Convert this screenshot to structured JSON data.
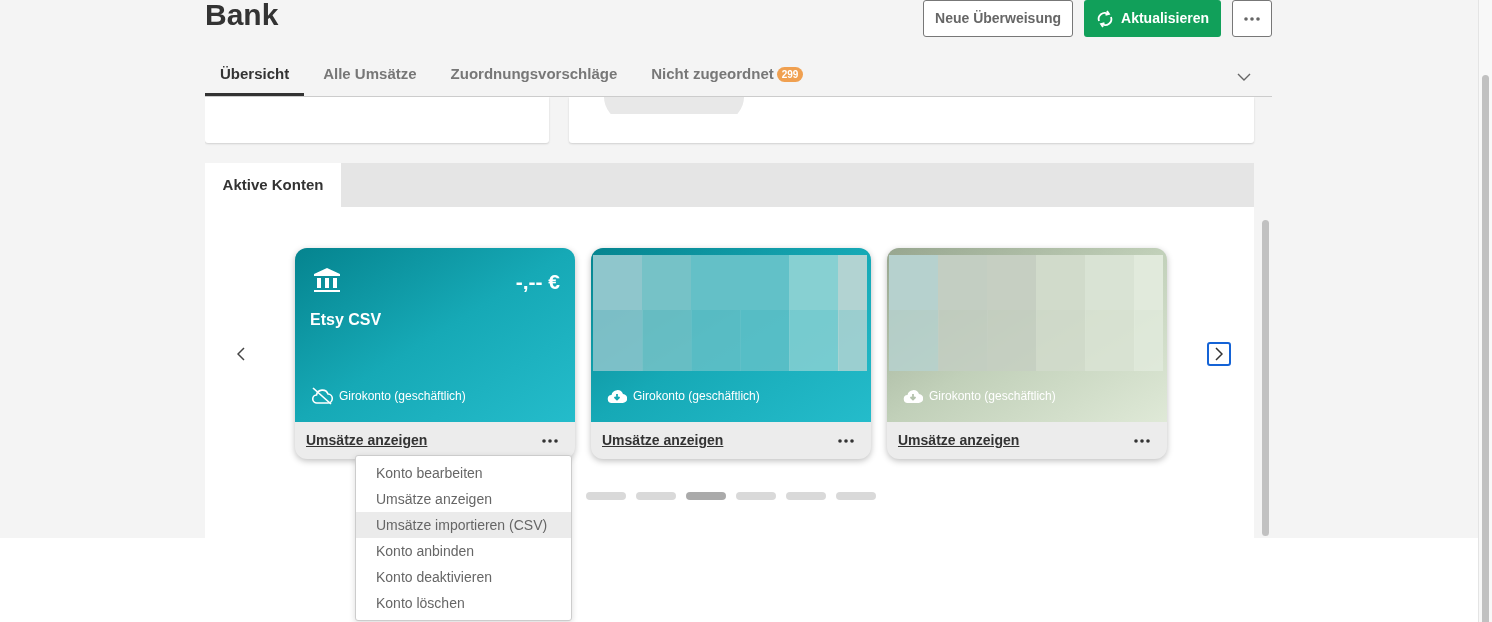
{
  "page": {
    "title": "Bank"
  },
  "actions": [
    {
      "kind": "outline",
      "label": "Neue Überweisung"
    },
    {
      "kind": "primary",
      "label": "Aktualisieren"
    },
    {
      "kind": "more"
    }
  ],
  "tabs": [
    {
      "label": "Übersicht",
      "selected": true
    },
    {
      "label": "Alle Umsätze",
      "selected": false
    },
    {
      "label": "Zuordnungsvorschläge",
      "selected": false
    },
    {
      "label": "Nicht zugeordnet",
      "selected": false,
      "badge": "299"
    }
  ],
  "section": {
    "title": "Aktive Konten"
  },
  "accounts": [
    {
      "kind": "teal",
      "name": "Etsy CSV",
      "balance": "-,-- €",
      "type": "Girokonto (geschäftlich)",
      "connected": false,
      "redacted": false,
      "link": "Umsätze anzeigen"
    },
    {
      "kind": "teal",
      "type": "Girokonto (geschäftlich)",
      "connected": true,
      "redacted": true,
      "link": "Umsätze anzeigen"
    },
    {
      "kind": "sage",
      "type": "Girokonto (geschäftlich)",
      "connected": true,
      "redacted": true,
      "link": "Umsätze anzeigen"
    }
  ],
  "pages": [
    {
      "selected": false
    },
    {
      "selected": false
    },
    {
      "selected": true
    },
    {
      "selected": false
    },
    {
      "selected": false
    },
    {
      "selected": false
    }
  ],
  "menu": [
    {
      "label": "Konto bearbeiten",
      "selected": false
    },
    {
      "label": "Umsätze anzeigen",
      "selected": false
    },
    {
      "label": "Umsätze importieren (CSV)",
      "selected": true
    },
    {
      "label": "Konto anbinden",
      "selected": false
    },
    {
      "label": "Konto deaktivieren",
      "selected": false
    },
    {
      "label": "Konto löschen",
      "selected": false
    }
  ]
}
